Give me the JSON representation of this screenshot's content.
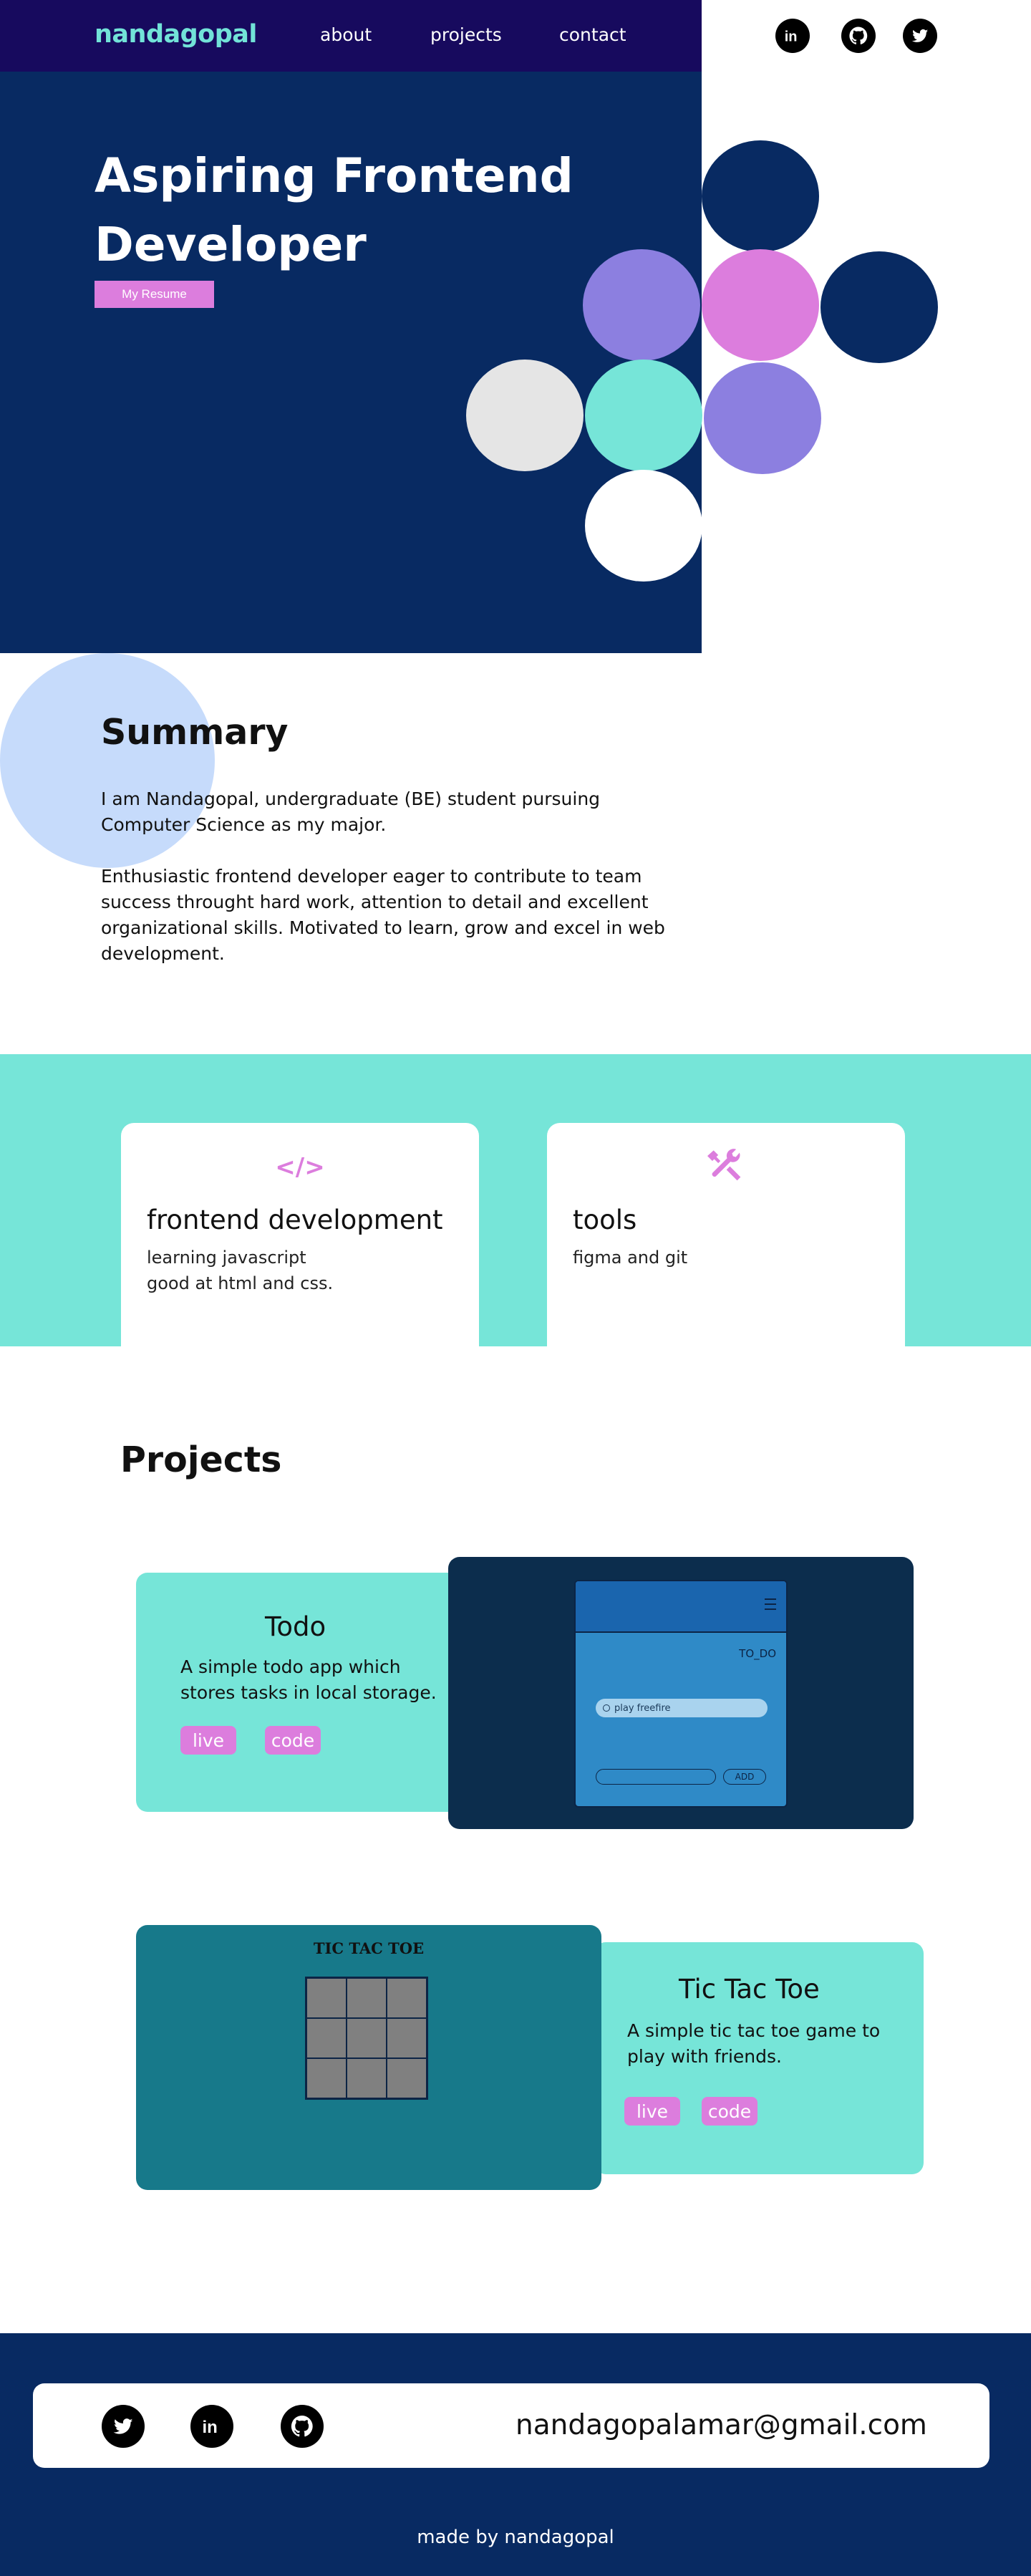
{
  "nav": {
    "logo": "nandagopal",
    "links": [
      "about",
      "projects",
      "contact"
    ],
    "socials": [
      "linkedin-icon",
      "github-icon",
      "twitter-icon"
    ]
  },
  "hero": {
    "title_line1": "Aspiring Frontend",
    "title_line2": "Developer",
    "resume_label": "My Resume"
  },
  "summary": {
    "title": "Summary",
    "p1": "I am Nandagopal, undergraduate (BE) student pursuing Computer Science as my major.",
    "p2": "Enthusiastic frontend developer eager to contribute to team success throught hard work, attention to detail and excellent organizational skills. Motivated to learn, grow and excel in web development."
  },
  "skills": [
    {
      "icon": "code-icon",
      "icon_glyph": "</>",
      "title": "frontend development",
      "lines": [
        "learning javascript",
        "good at html and css."
      ]
    },
    {
      "icon": "tools-icon",
      "icon_glyph": "",
      "title": "tools",
      "lines": [
        "figma and git"
      ]
    }
  ],
  "projects": {
    "title": "Projects",
    "items": [
      {
        "name": "Todo",
        "desc_line1": "A simple todo app which",
        "desc_line2": "stores tasks in local storage.",
        "live": "live",
        "code": "code",
        "preview": {
          "label": "TO_DO",
          "task": "play freefire",
          "add": "ADD"
        }
      },
      {
        "name": "Tic Tac Toe",
        "desc_line1": "A simple tic tac toe game to",
        "desc_line2": "play with friends.",
        "live": "live",
        "code": "code",
        "preview": {
          "title": "TIC TAC TOE"
        }
      }
    ]
  },
  "footer": {
    "socials": [
      "twitter-icon",
      "linkedin-icon",
      "github-icon"
    ],
    "email": "nandagopalamar@gmail.com",
    "made_by": "made by nandagopal"
  },
  "colors": {
    "navy": "#082a62",
    "nav_purple": "#170a5e",
    "teal": "#76e5d8",
    "pink": "#dc7ddd",
    "lavender": "#8c7fe0",
    "light_blue": "#c6dbfb"
  }
}
